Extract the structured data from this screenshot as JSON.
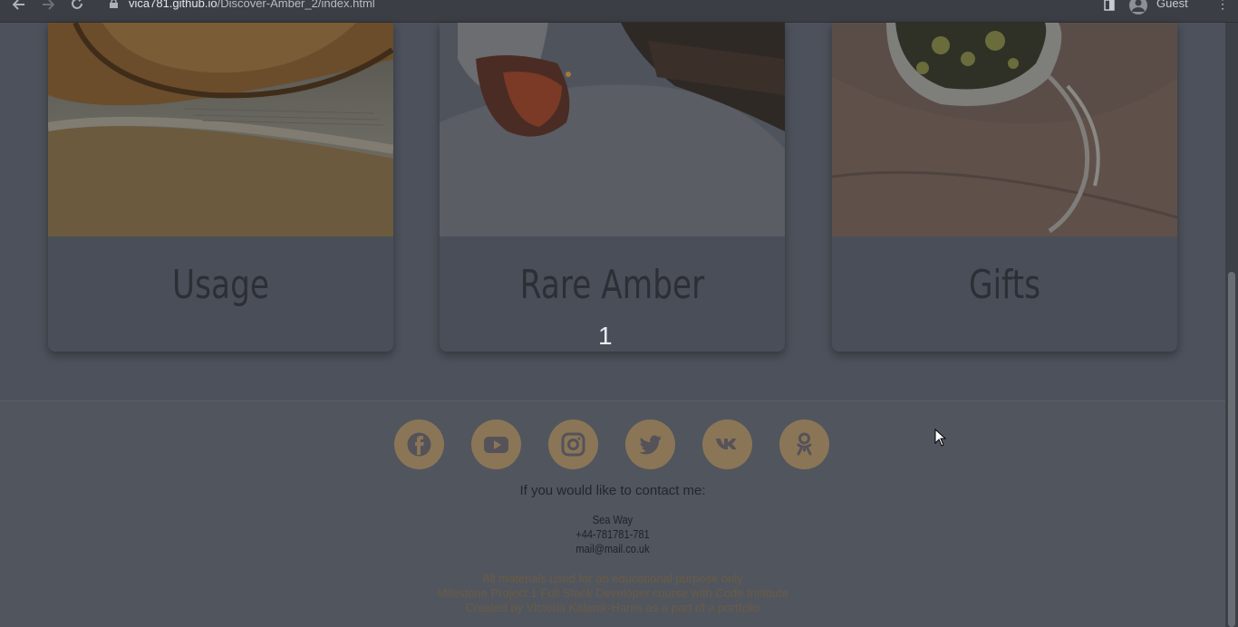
{
  "browser": {
    "url_host": "vica781.github.io",
    "url_path": "/Discover-Amber_2/index.html",
    "profile_label": "Guest"
  },
  "cards": [
    {
      "title": "Usage",
      "photo": "violin-on-sheet-music"
    },
    {
      "title": "Rare Amber",
      "photo": "amber-piece-on-bark"
    },
    {
      "title": "Gifts",
      "photo": "amber-ring-on-hand"
    }
  ],
  "page_number": "1",
  "footer": {
    "socials": [
      {
        "icon": "facebook-icon"
      },
      {
        "icon": "youtube-icon"
      },
      {
        "icon": "instagram-icon"
      },
      {
        "icon": "twitter-icon"
      },
      {
        "icon": "vk-icon"
      },
      {
        "icon": "odnoklassniki-icon"
      }
    ],
    "contact_heading": "If you would like to contact me:",
    "address": "Sea Way",
    "phone": "+44-781781-781",
    "email": "mail@mail.co.uk",
    "copyright_lines": [
      "All materials used for an educational purpose only",
      "Milestone Project 1 Full Stack Developer course with Code Institute",
      "Created by Victoria Kalenik-Harris as a part of a portfolio"
    ]
  },
  "colors": {
    "page_bg": "#4d515b",
    "footer_bg": "#51555e",
    "social_circle": "#8a7656",
    "card_title": "#2c2f35"
  }
}
